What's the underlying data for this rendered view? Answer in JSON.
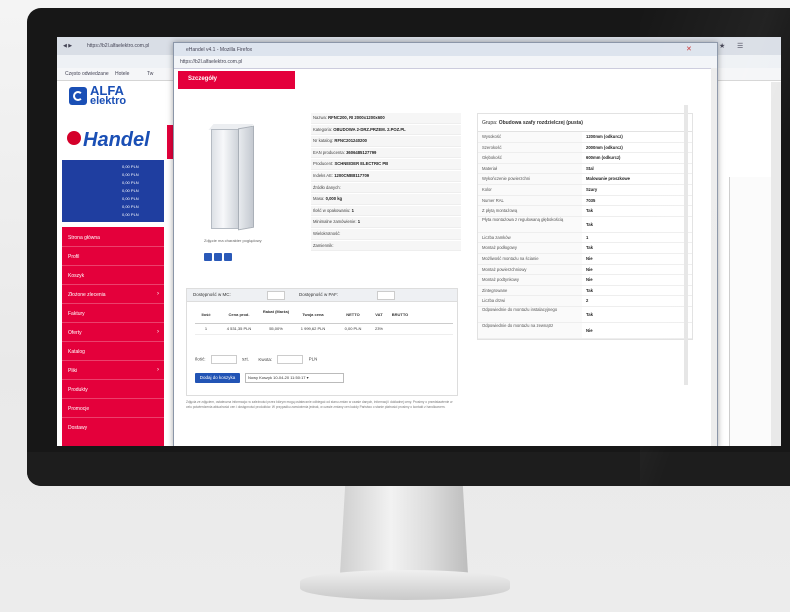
{
  "browser": {
    "tab_title": "",
    "address": "https://b2l.alfaelektro.com.pl",
    "bookmarks": [
      "Często odwiedzane",
      "Hotele",
      "Tw"
    ]
  },
  "brand": {
    "logo_line1": "ALFA",
    "logo_line2": "elektro",
    "logo_sub": "",
    "handel": "Handel"
  },
  "account_box": [
    {
      "label": "",
      "value": "0,00 PLN"
    },
    {
      "label": "",
      "value": "0,00 PLN"
    },
    {
      "label": "",
      "value": "0,00 PLN"
    },
    {
      "label": "",
      "value": "0,00 PLN"
    },
    {
      "label": "",
      "value": "0,00 PLN"
    },
    {
      "label": "",
      "value": "0,00 PLN"
    },
    {
      "label": "",
      "value": "0,00 PLN"
    }
  ],
  "sidebar_menu": [
    {
      "label": "Strona główna",
      "arrow": false
    },
    {
      "label": "Profil",
      "arrow": false
    },
    {
      "label": "Koszyk",
      "arrow": false
    },
    {
      "label": "Złożone zlecenia",
      "arrow": true
    },
    {
      "label": "Faktury",
      "arrow": false
    },
    {
      "label": "Oferty",
      "arrow": true
    },
    {
      "label": "Katalog",
      "arrow": false
    },
    {
      "label": "Pliki",
      "arrow": true
    },
    {
      "label": "Produkty",
      "arrow": false
    },
    {
      "label": "Promocje",
      "arrow": false
    },
    {
      "label": "Dostawy",
      "arrow": false
    }
  ],
  "popup": {
    "window_title": "eHandel v4.1 - Mozilla Firefox",
    "address": "https://b2l.alfaelektro.com.pl",
    "header": "Szczegóły",
    "image_caption": "Zdjęcie ma charakter poglądowy",
    "attributes": [
      {
        "label": "Nazwa:",
        "value": "RFNC200, RI 2000x1200x600"
      },
      {
        "label": "Kategoria:",
        "value": "OBUDOWA 2-DRZ.PRZEM. 2.POZ.PL"
      },
      {
        "label": "Nr katalog:",
        "value": "RFNC201240200"
      },
      {
        "label": "EAN producenta:",
        "value": "3606485127799"
      },
      {
        "label": "Producent:",
        "value": "SCHNEIDER ELECTRIC PB"
      },
      {
        "label": "Indeks AE:",
        "value": "1200CMB8117709"
      },
      {
        "label": "Źródło danych:",
        "value": ""
      },
      {
        "label": "Masa:",
        "value": "0,000 kg"
      },
      {
        "label": "Ilość w opakowaniu:",
        "value": "1"
      },
      {
        "label": "Minimalne zamówienie:",
        "value": "1"
      },
      {
        "label": "Wielokrotność:",
        "value": ""
      },
      {
        "label": "Zamiennik:",
        "value": ""
      }
    ],
    "params_header_label": "Grupa:",
    "params_header_value": "Obudowa szafy rozdzielczej (pusta)",
    "params": [
      {
        "k": "Wysokość",
        "v": "1200mm (odkurcz)"
      },
      {
        "k": "Szerokość",
        "v": "2000mm (odkurcz)"
      },
      {
        "k": "Głębokość",
        "v": "600mm (odkurcz)"
      },
      {
        "k": "Materiał",
        "v": "Stal"
      },
      {
        "k": "Wykończenie powierzchni",
        "v": "Malowanie proszkowe"
      },
      {
        "k": "Kolor",
        "v": "Szary"
      },
      {
        "k": "Numer RAL",
        "v": "7035"
      },
      {
        "k": "Z płytą montażową",
        "v": "Tak"
      },
      {
        "k": "Płyta montażowa z regulowaną głębokością",
        "v": "Tak",
        "tall": true
      },
      {
        "k": "Liczba zamków",
        "v": "1"
      },
      {
        "k": "Montaż podłogowy",
        "v": "Tak"
      },
      {
        "k": "Możliwość montażu na ścianie",
        "v": "Nie"
      },
      {
        "k": "Montaż powierzchniowy",
        "v": "Nie"
      },
      {
        "k": "Montaż podtynkowy",
        "v": "Nie"
      },
      {
        "k": "Zintegrowane",
        "v": "Tak"
      },
      {
        "k": "Liczba drzwi",
        "v": "2"
      },
      {
        "k": "Odpowiednie do montażu instalacyjnego",
        "v": "Tak",
        "tall": true
      },
      {
        "k": "Odpowiednie do montażu na zewnątrz",
        "v": "Nie",
        "tall": true
      }
    ],
    "stock_tabs": [
      {
        "label": "Dostępność w MC:",
        "box": ""
      },
      {
        "label": "Dostępność w PAF:",
        "box": ""
      }
    ],
    "price_headers": [
      "Ilość",
      "Cena prod.",
      "Rabat (Marża)",
      "Twoja cena",
      "NETTO",
      "VAT",
      "BRUTTO"
    ],
    "price_row": [
      "1",
      "4 531,35 PLN",
      "55,00%",
      "1 999,62 PLN",
      "0,00 PLN",
      "23%",
      ""
    ],
    "qty_label": "Ilość:",
    "qty_unit": "szt.",
    "value_label": "Kwota:",
    "value_unit": "PLN",
    "add_button": "Dodaj do koszyka",
    "cart_select": "Nowy Koszyk 10-04-20 11:50:17",
    "footer": "Zdjęcia ze zdjęciem, ostateczna informacja: w zależności przez którym mogą ostatecznie odbiegać od stanu zmian w czasie danych, informacji i dokładnej ceny. Prosimy o przedstawienie w celu potwierdzenia aktualności cen i dostępności produktów. W przypadku zamówienia jednak, w czasie zmiany cen każdy Państwo o stanie płatności prosimy o kontakt z handlowcem."
  }
}
